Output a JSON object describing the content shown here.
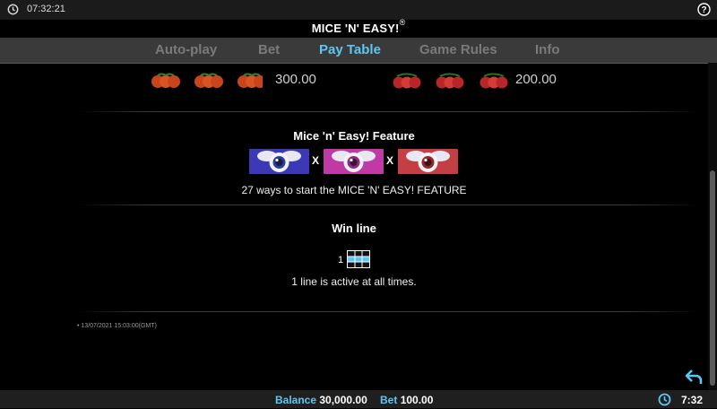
{
  "status_bar": {
    "time": "07:32:21"
  },
  "header": {
    "title": "MICE 'N' EASY!",
    "title_mark": "®"
  },
  "tabs": [
    {
      "label": "Auto-play",
      "active": false
    },
    {
      "label": "Bet",
      "active": false
    },
    {
      "label": "Pay Table",
      "active": true
    },
    {
      "label": "Game Rules",
      "active": false
    },
    {
      "label": "Info",
      "active": false
    }
  ],
  "paytable": {
    "oranges_value": "300.00",
    "cherries_value": "200.00"
  },
  "feature": {
    "title": "Mice 'n' Easy! Feature",
    "times_sign": "X",
    "description": "27 ways to start the MICE 'N' EASY! FEATURE",
    "tile_colors": [
      "#3c39b7",
      "#c03aa6",
      "#c33f44"
    ]
  },
  "win_line": {
    "title": "Win line",
    "line_number": "1",
    "description": "1 line is active at all times.",
    "highlight_color": "#5fc5f3"
  },
  "timestamp": "13/07/2021 15:03:00(GMT)",
  "footer": {
    "balance_label": "Balance",
    "balance_value": "30,000.00",
    "bet_label": "Bet",
    "bet_value": "100.00",
    "time": "7:32"
  },
  "colors": {
    "accent": "#5fc5f3",
    "tab_bar": "#3a3a3a",
    "inactive_tab": "#7a7a7a"
  }
}
